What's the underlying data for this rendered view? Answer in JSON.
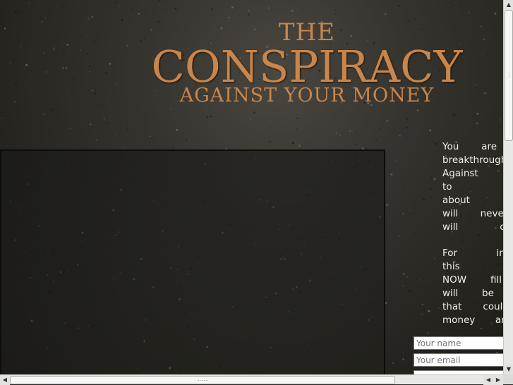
{
  "logo": {
    "the": "THE",
    "main": "CONSPIRACY",
    "sub": "AGAINST YOUR MONEY"
  },
  "copy": {
    "para1": [
      "You are view",
      "breakthrough",
      "Against YOUR",
      "to possess",
      "about money",
      "will never kn",
      "will continue"
    ],
    "para2": [
      "For instructio",
      "this breakt",
      "NOW fill out",
      "will be direc",
      "that could ch",
      "money and w"
    ]
  },
  "form": {
    "name_placeholder": "Your name",
    "email_placeholder": "Your email"
  },
  "scrollbar": {
    "up_icon": "arrow-up-icon",
    "down_icon": "arrow-down-icon",
    "left_icon": "arrow-left-icon",
    "right_icon": "arrow-right-icon"
  }
}
